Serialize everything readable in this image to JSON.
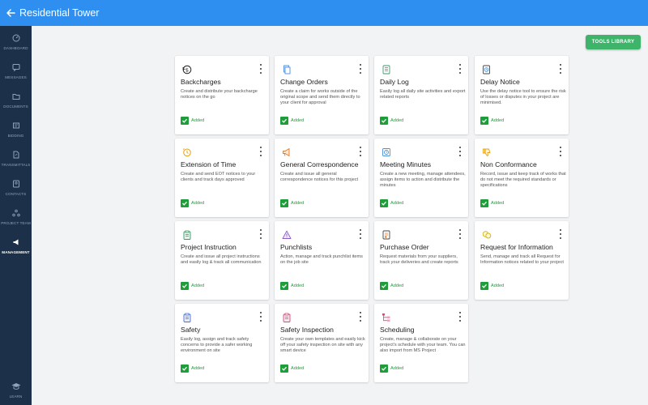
{
  "header": {
    "title": "Residential Tower"
  },
  "sidebar": {
    "items": [
      {
        "label": "Dashboard"
      },
      {
        "label": "Messages"
      },
      {
        "label": "Documents"
      },
      {
        "label": "Bidding"
      },
      {
        "label": "Transmittals"
      },
      {
        "label": "Contacts"
      },
      {
        "label": "Project Team"
      },
      {
        "label": "Management"
      },
      {
        "label": "Learn"
      }
    ]
  },
  "toolbar": {
    "tools_library_label": "TOOLS LIBRARY"
  },
  "colors": {
    "header": "#2f8ff0",
    "sidebar": "#1c3149",
    "accent_green": "#3db46a",
    "added_green": "#1f9d3a"
  },
  "tools": [
    {
      "title": "Backcharges",
      "desc": "Create and distribute your backcharge notices on the go",
      "status": "Added",
      "icon": "money-back-icon"
    },
    {
      "title": "Change Orders",
      "desc": "Create a claim for works outside of the original scope and send them directly to your client for approval",
      "status": "Added",
      "icon": "document-copy-icon"
    },
    {
      "title": "Daily Log",
      "desc": "Easily log all daily site activities and export related reports",
      "status": "Added",
      "icon": "log-sheet-icon"
    },
    {
      "title": "Delay Notice",
      "desc": "Use the delay notice tool to ensure the risk of losses or disputes in your project are minimised.",
      "status": "Added",
      "icon": "clock-document-icon"
    },
    {
      "title": "Extension of Time",
      "desc": "Create and send EOT notices to your clients and track days approved",
      "status": "Added",
      "icon": "clock-arrow-icon"
    },
    {
      "title": "General Correspondence",
      "desc": "Create and issue all general correspondence notices for this project",
      "status": "Added",
      "icon": "megaphone-icon"
    },
    {
      "title": "Meeting Minutes",
      "desc": "Create a new meeting, manage attendees, assign items to action and distribute the minutes",
      "status": "Added",
      "icon": "meeting-clock-icon"
    },
    {
      "title": "Non Conformance",
      "desc": "Record, issue and keep track of works that do not meet the required standards or specifications",
      "status": "Added",
      "icon": "thumbs-down-icon"
    },
    {
      "title": "Project Instruction",
      "desc": "Create and issue all project instructions and easily log & track all communication",
      "status": "Added",
      "icon": "clipboard-icon"
    },
    {
      "title": "Punchlists",
      "desc": "Action, manage and track punchlist items on the job site",
      "status": "Added",
      "icon": "warning-triangle-icon"
    },
    {
      "title": "Purchase Order",
      "desc": "Request materials from your suppliers, track your deliveries and create reports",
      "status": "Added",
      "icon": "purchase-document-icon"
    },
    {
      "title": "Request for Information",
      "desc": "Send, manage and track all Request for Information notices related to your project",
      "status": "Added",
      "icon": "chat-bubbles-icon"
    },
    {
      "title": "Safety",
      "desc": "Easily log, assign and track safety concerns to provide a safer working environment on site",
      "status": "Added",
      "icon": "safety-clipboard-icon"
    },
    {
      "title": "Safety Inspection",
      "desc": "Create your own templates and easily kick off your safety inspection on site with any smart device",
      "status": "Added",
      "icon": "inspection-clipboard-icon"
    },
    {
      "title": "Scheduling",
      "desc": "Create, manage & collaborate on your project's schedule with your team. You can also import from MS Project",
      "status": "Added",
      "icon": "schedule-tree-icon"
    }
  ]
}
